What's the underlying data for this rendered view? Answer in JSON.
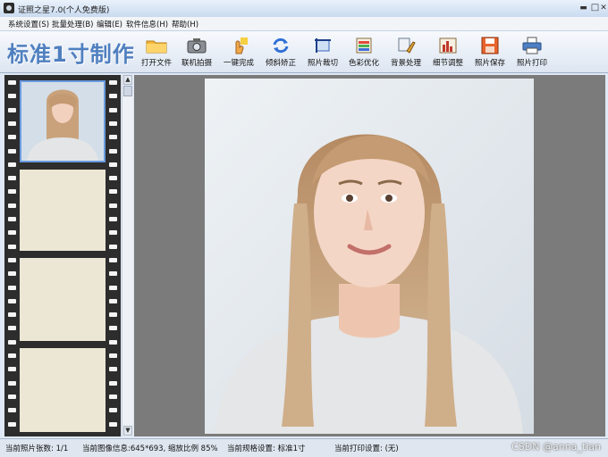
{
  "window": {
    "title": "证照之星7.0(个人免费版)",
    "min_glyph": "▬",
    "max_glyph": "□",
    "close_glyph": "✕"
  },
  "menu": [
    {
      "label": "系统设置(S)"
    },
    {
      "label": "批量处理(B)"
    },
    {
      "label": "编辑(E)"
    },
    {
      "label": "软件信息(H)"
    },
    {
      "label": "帮助(H)"
    }
  ],
  "brand": "标准1寸制作",
  "toolbar": [
    {
      "label": "打开文件",
      "icon": "folder-icon"
    },
    {
      "label": "联机拍摄",
      "icon": "camera-icon"
    },
    {
      "label": "一键完成",
      "icon": "hand-icon"
    },
    {
      "label": "倾斜矫正",
      "icon": "rotate-icon"
    },
    {
      "label": "照片裁切",
      "icon": "crop-icon"
    },
    {
      "label": "色彩优化",
      "icon": "palette-icon"
    },
    {
      "label": "背景处理",
      "icon": "brush-icon"
    },
    {
      "label": "细节调整",
      "icon": "chart-icon"
    },
    {
      "label": "照片保存",
      "icon": "save-icon"
    },
    {
      "label": "照片打印",
      "icon": "printer-icon"
    }
  ],
  "scroll": {
    "up": "▲",
    "down": "▼"
  },
  "status": [
    {
      "label": "当前照片张数: 1/1"
    },
    {
      "label": "当前图像信息:645*693, 缩放比例 85%"
    },
    {
      "label": "当前规格设置: 标准1寸"
    },
    {
      "label": "当前打印设置: (无)"
    }
  ],
  "watermark": "CSDN @anna_tian",
  "colors": {
    "brand": "#4f7fbf",
    "film": "#2d2d2d",
    "canvas": "#7b7b7b"
  }
}
